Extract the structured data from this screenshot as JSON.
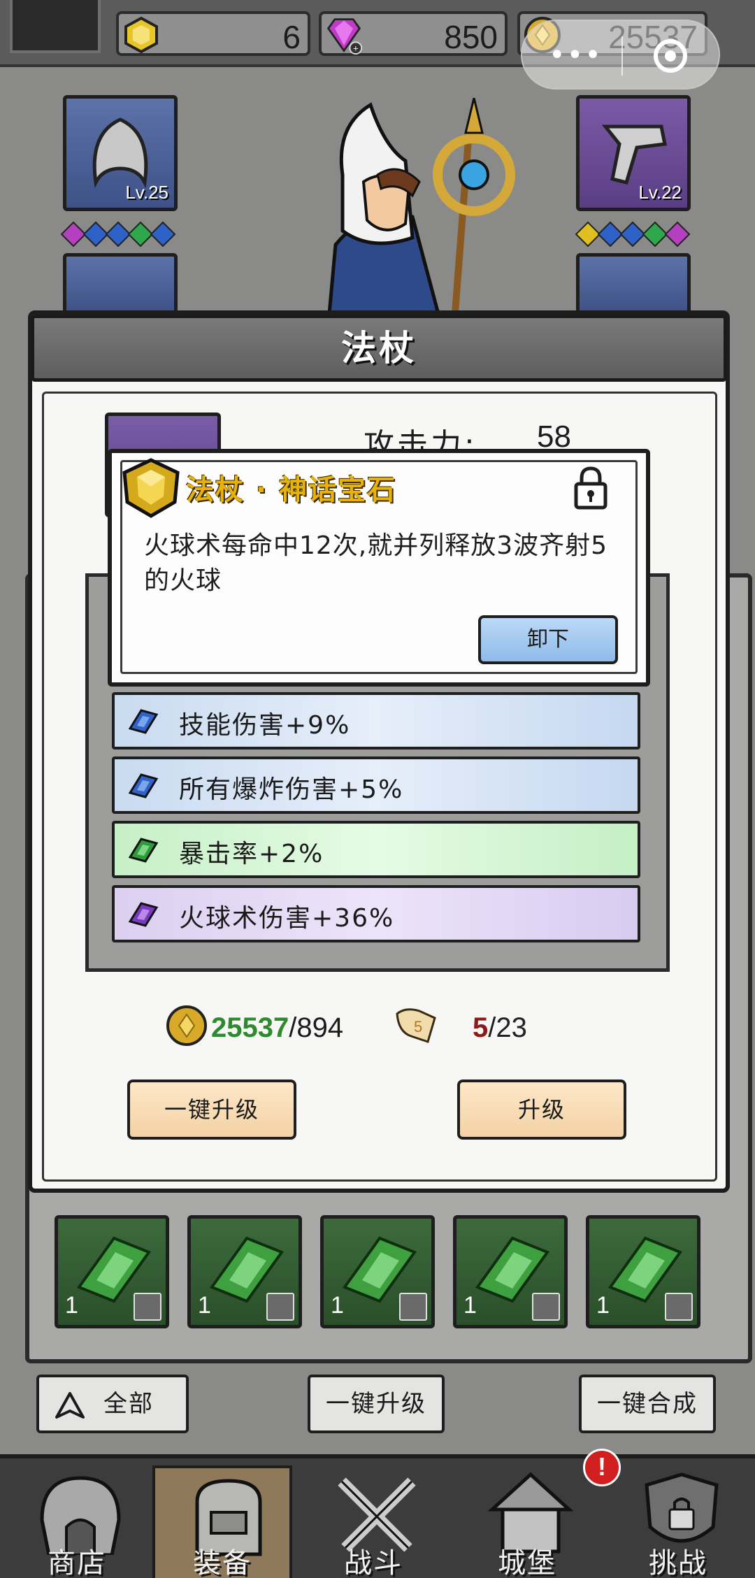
{
  "resources": {
    "gems": "6",
    "diamonds": "850",
    "gold": "25537"
  },
  "equipment": {
    "hood_level": "Lv.25",
    "pants_level": "Lv.22"
  },
  "dialog": {
    "title": "法杖",
    "attack_label": "攻击力:",
    "attack_value": "58"
  },
  "gem_popup": {
    "title": "法杖 · 神话宝石",
    "description": "火球术每命中12次,就并列释放3波齐射5的火球",
    "unequip_label": "卸下"
  },
  "stats": [
    {
      "text": "技能伤害+9%",
      "tier": "blue"
    },
    {
      "text": "所有爆炸伤害+5%",
      "tier": "blue"
    },
    {
      "text": "暴击率+2%",
      "tier": "green"
    },
    {
      "text": "火球术伤害+36%",
      "tier": "purple"
    }
  ],
  "cost": {
    "gold_have": "25537",
    "gold_need": "/894",
    "scroll_have": "5",
    "scroll_need": "/23"
  },
  "buttons": {
    "upgrade_all": "一键升级",
    "upgrade": "升级",
    "filter_all": "全部",
    "bulk_upgrade": "一键升级",
    "bulk_merge": "一键合成"
  },
  "gem_inventory": [
    {
      "qty": "1"
    },
    {
      "qty": "1"
    },
    {
      "qty": "1"
    },
    {
      "qty": "1"
    },
    {
      "qty": "1"
    }
  ],
  "tabs": {
    "shop": "商店",
    "equipment": "装备",
    "battle": "战斗",
    "castle": "城堡",
    "challenge": "挑战",
    "castle_badge": "!"
  },
  "colors": {
    "gold_have": "#2e8a2e",
    "scroll_have": "#8b1a1a",
    "popup_title": "#e8b20a"
  }
}
